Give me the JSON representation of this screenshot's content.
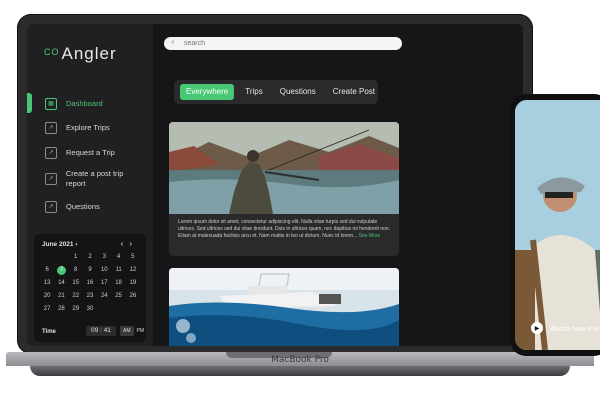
{
  "app": {
    "logo_mark": "CO",
    "logo_text": "Angler",
    "accent_color": "#48c774"
  },
  "sidebar": {
    "items": [
      {
        "label": "Dashboard",
        "icon": "grid-icon",
        "active": true
      },
      {
        "label": "Explore Trips",
        "icon": "chart-icon"
      },
      {
        "label": "Request a Trip",
        "icon": "chart-icon"
      },
      {
        "label": "Create a post trip report",
        "icon": "chart-icon"
      },
      {
        "label": "Questions",
        "icon": "chart-icon"
      }
    ]
  },
  "calendar": {
    "month": "June 2021 ›",
    "prev": "‹",
    "next": "›",
    "days": [
      "",
      "",
      "1",
      "2",
      "3",
      "4",
      "5",
      "6",
      "7",
      "8",
      "9",
      "10",
      "11",
      "12",
      "13",
      "14",
      "15",
      "16",
      "17",
      "18",
      "19",
      "20",
      "21",
      "22",
      "23",
      "24",
      "25",
      "26",
      "27",
      "28",
      "29",
      "30",
      "",
      "",
      ""
    ],
    "selected_day": "7",
    "time_label": "Time",
    "time_value": "09 : 41",
    "am": "AM",
    "pm": "PM"
  },
  "search": {
    "placeholder": "search"
  },
  "tabs": [
    {
      "label": "Everywhere",
      "active": true
    },
    {
      "label": "Trips"
    },
    {
      "label": "Questions"
    },
    {
      "label": "Create Post"
    }
  ],
  "post": {
    "text": "Lorem ipsum dolor sit amet, consectetur adipiscing elit. Nulla vitae turpis sed dui vulputate ultrices. Sed ultrices sed dui vitae tincidunt. Duis in ultrices quam, nec dapibus mi hendrerit non. Etiam at malesuada facilisis arcu et. Nam mattis in leo ut dictum. Nunc id lorem...",
    "more": "See More"
  },
  "laptop": {
    "label": "MacBook Pro"
  },
  "phone": {
    "watch_label": "Watch how it w"
  }
}
